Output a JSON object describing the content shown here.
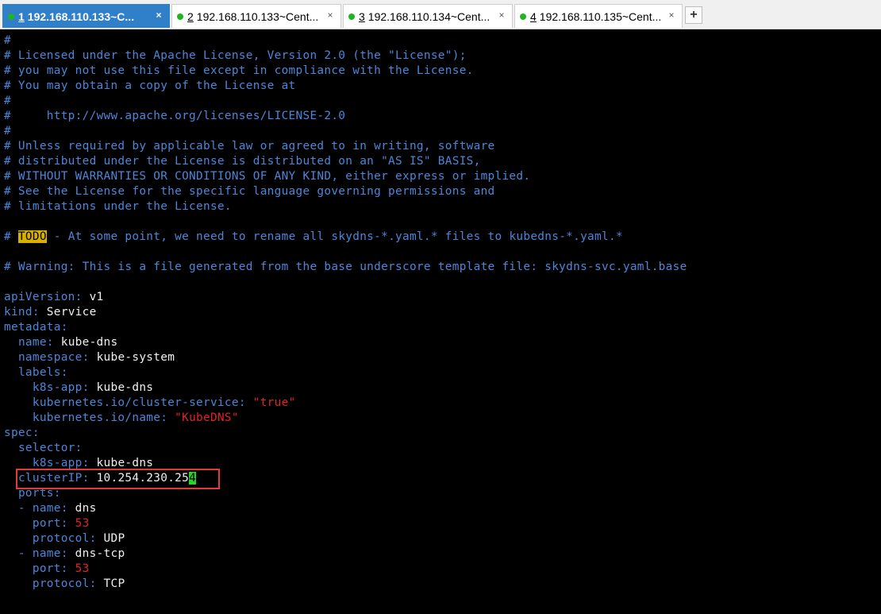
{
  "tabs": [
    {
      "num": "1",
      "label": "192.168.110.133~C...",
      "active": true
    },
    {
      "num": "2",
      "label": "192.168.110.133~Cent...",
      "active": false
    },
    {
      "num": "3",
      "label": "192.168.110.134~Cent...",
      "active": false
    },
    {
      "num": "4",
      "label": "192.168.110.135~Cent...",
      "active": false
    }
  ],
  "add_tab_label": "+",
  "close_glyph": "×",
  "editor": {
    "l1": "#",
    "l2": "# Licensed under the Apache License, Version 2.0 (the \"License\");",
    "l3": "# you may not use this file except in compliance with the License.",
    "l4": "# You may obtain a copy of the License at",
    "l5": "#",
    "l6": "#     http://www.apache.org/licenses/LICENSE-2.0",
    "l7": "#",
    "l8": "# Unless required by applicable law or agreed to in writing, software",
    "l9": "# distributed under the License is distributed on an \"AS IS\" BASIS,",
    "l10": "# WITHOUT WARRANTIES OR CONDITIONS OF ANY KIND, either express or implied.",
    "l11": "# See the License for the specific language governing permissions and",
    "l12": "# limitations under the License.",
    "todo_prefix": "# ",
    "todo_word": "TODO",
    "todo_rest": " - At some point, we need to rename all skydns-*.yaml.* files to kubedns-*.yaml.*",
    "warning": "# Warning: This is a file generated from the base underscore template file: skydns-svc.yaml.base",
    "api_key": "apiVersion",
    "api_val": "v1",
    "kind_key": "kind",
    "kind_val": "Service",
    "meta_key": "metadata",
    "name_key": "name",
    "name_val": "kube-dns",
    "ns_key": "namespace",
    "ns_val": "kube-system",
    "labels_key": "labels",
    "app_key": "k8s-app",
    "app_val": "kube-dns",
    "cs_key": "kubernetes.io/cluster-service",
    "cs_val": "\"true\"",
    "kn_key": "kubernetes.io/name",
    "kn_val": "\"KubeDNS\"",
    "spec_key": "spec",
    "selector_key": "selector",
    "sel_app_key": "k8s-app",
    "sel_app_val": "kube-dns",
    "cip_key": "clusterIP",
    "cip_val": "10.254.230.25",
    "cip_cursor": "4",
    "ports_key": "ports",
    "p1_name_key": "name",
    "p1_name_val": "dns",
    "p1_port_key": "port",
    "p1_port_val": "53",
    "p1_proto_key": "protocol",
    "p1_proto_val": "UDP",
    "p2_name_key": "name",
    "p2_name_val": "dns-tcp",
    "p2_port_key": "port",
    "p2_port_val": "53",
    "p2_proto_key": "protocol",
    "p2_proto_val": "TCP"
  },
  "colors": {
    "comment": "#4d86d8",
    "key": "#4d86d8",
    "value": "#f0f0f0",
    "string_number": "#e02424",
    "todo_bg": "#d8b000",
    "cursor_bg": "#2ad22a",
    "highlight_border": "#e13a3a",
    "active_tab": "#2f7fc9"
  }
}
